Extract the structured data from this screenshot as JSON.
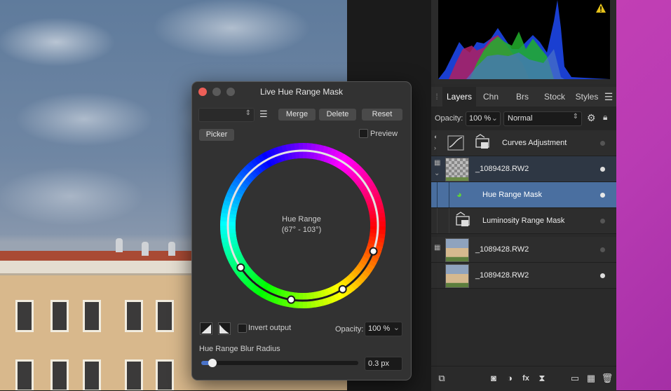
{
  "dialog": {
    "title": "Live Hue Range Mask",
    "preset_value": "",
    "merge_label": "Merge",
    "delete_label": "Delete",
    "reset_label": "Reset",
    "picker_label": "Picker",
    "preview_label": "Preview",
    "wheel_title": "Hue Range",
    "wheel_range": "(67° - 103°)",
    "invert_label": "Invert output",
    "opacity_label": "Opacity:",
    "opacity_value": "100 %",
    "blur_label": "Hue Range Blur Radius",
    "blur_value": "0.3 px",
    "blur_fraction": 0.07
  },
  "tabs": [
    "Layers",
    "Chn",
    "Brs",
    "Stock",
    "Styles"
  ],
  "layers_opts": {
    "opacity_label": "Opacity:",
    "opacity_value": "100 %",
    "blend_mode": "Normal"
  },
  "layers": [
    {
      "name": "Curves Adjustment"
    },
    {
      "name": "_1089428.RW2"
    },
    {
      "name": "Hue Range Mask"
    },
    {
      "name": "Luminosity Range Mask"
    },
    {
      "name": "_1089428.RW2"
    },
    {
      "name": "_1089428.RW2"
    }
  ],
  "colors": {
    "selected_row": "#4a6fa0",
    "panel_bg": "#2a2a2a",
    "desktop_magenta": "#b93bb3"
  }
}
